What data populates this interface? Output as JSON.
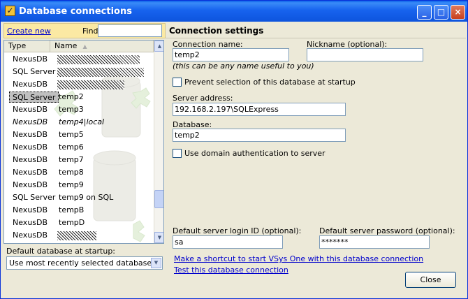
{
  "window": {
    "title": "Database connections",
    "title_icon": "vsys-checkmark-icon"
  },
  "titlebar_buttons": {
    "minimize": "_",
    "maximize": "□",
    "close": "×"
  },
  "left": {
    "create_new": "Create new",
    "find_label": "Find:",
    "find_value": "",
    "columns": {
      "type": "Type",
      "name": "Name",
      "sort_indicator": "▲"
    },
    "rows": [
      {
        "type": "NexusDB",
        "name": "",
        "obscured": true
      },
      {
        "type": "SQL Server",
        "name": "",
        "obscured": true
      },
      {
        "type": "NexusDB",
        "name": "",
        "obscured": true
      },
      {
        "type": "SQL Server",
        "name": "temp2",
        "selected": true
      },
      {
        "type": "NexusDB",
        "name": "temp3"
      },
      {
        "type": "NexusDB",
        "name": "temp4|local",
        "italic": true
      },
      {
        "type": "NexusDB",
        "name": "temp5"
      },
      {
        "type": "NexusDB",
        "name": "temp6"
      },
      {
        "type": "NexusDB",
        "name": "temp7"
      },
      {
        "type": "NexusDB",
        "name": "temp8"
      },
      {
        "type": "NexusDB",
        "name": "temp9"
      },
      {
        "type": "SQL Server",
        "name": "temp9 on SQL"
      },
      {
        "type": "NexusDB",
        "name": "tempB"
      },
      {
        "type": "NexusDB",
        "name": "tempD"
      },
      {
        "type": "NexusDB",
        "name": "",
        "obscured": true
      }
    ],
    "default_label": "Default database at startup:",
    "default_value": "Use most recently selected database"
  },
  "right": {
    "title": "Connection settings",
    "conn_name_label": "Connection name:",
    "conn_name_value": "temp2",
    "conn_name_hint": "(this can be any name useful to you)",
    "nickname_label": "Nickname (optional):",
    "nickname_value": "",
    "prevent_label": "Prevent selection of this database at startup",
    "server_label": "Server address:",
    "server_value": "192.168.2.197\\SQLExpress",
    "database_label": "Database:",
    "database_value": "temp2",
    "domain_auth_label": "Use domain authentication to server",
    "login_label": "Default server login ID (optional):",
    "login_value": "sa",
    "password_label": "Default server password (optional):",
    "password_value": "*******",
    "shortcut_link": "Make a shortcut to start VSys One with this database connection",
    "test_link": "Test this database connection",
    "close_label": "Close"
  },
  "colors": {
    "title_bar": "#0d54dd",
    "find_toolbar": "#fbe9a3",
    "link": "#0000cc",
    "selection": "#c0c0c0",
    "dialog_face": "#ece9d8"
  }
}
